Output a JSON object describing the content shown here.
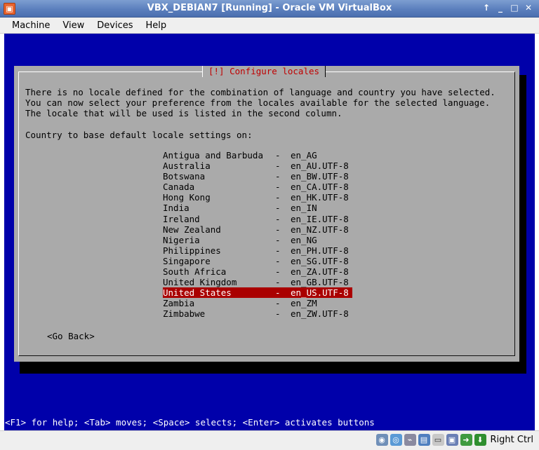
{
  "window": {
    "title": "VBX_DEBIAN7 [Running] - Oracle VM VirtualBox",
    "controls": [
      "↑",
      "_",
      "□",
      "✕"
    ]
  },
  "menu": [
    "Machine",
    "View",
    "Devices",
    "Help"
  ],
  "dialog": {
    "title": "[!] Configure locales",
    "description": [
      "There is no locale defined for the combination of language and country you have selected.",
      "You can now select your preference from the locales available for the selected language.",
      "The locale that will be used is listed in the second column."
    ],
    "prompt": "Country to base default locale settings on:",
    "separator": "-",
    "locales": [
      {
        "country": "Antigua and Barbuda",
        "code": "en_AG"
      },
      {
        "country": "Australia",
        "code": "en_AU.UTF-8"
      },
      {
        "country": "Botswana",
        "code": "en_BW.UTF-8"
      },
      {
        "country": "Canada",
        "code": "en_CA.UTF-8"
      },
      {
        "country": "Hong Kong",
        "code": "en_HK.UTF-8"
      },
      {
        "country": "India",
        "code": "en_IN"
      },
      {
        "country": "Ireland",
        "code": "en_IE.UTF-8"
      },
      {
        "country": "New Zealand",
        "code": "en_NZ.UTF-8"
      },
      {
        "country": "Nigeria",
        "code": "en_NG"
      },
      {
        "country": "Philippines",
        "code": "en_PH.UTF-8"
      },
      {
        "country": "Singapore",
        "code": "en_SG.UTF-8"
      },
      {
        "country": "South Africa",
        "code": "en_ZA.UTF-8"
      },
      {
        "country": "United Kingdom",
        "code": "en_GB.UTF-8"
      },
      {
        "country": "United States",
        "code": "en_US.UTF-8",
        "selected": true
      },
      {
        "country": "Zambia",
        "code": "en_ZM"
      },
      {
        "country": "Zimbabwe",
        "code": "en_ZW.UTF-8"
      }
    ],
    "go_back": "<Go Back>"
  },
  "help_line": "<F1> for help; <Tab> moves; <Space> selects; <Enter> activates buttons",
  "statusbar": {
    "icons": [
      "hard-disk-icon",
      "cd-drive-icon",
      "usb-icon",
      "shared-folders-icon",
      "network-icon",
      "display-icon",
      "mouse-integration-icon",
      "host-key-icon"
    ],
    "host_key": "Right Ctrl"
  },
  "colors": {
    "console_bg": "#0000aa",
    "dialog_bg": "#aaaaaa",
    "title_red": "#c00000",
    "selection_bg": "#aa0000"
  }
}
